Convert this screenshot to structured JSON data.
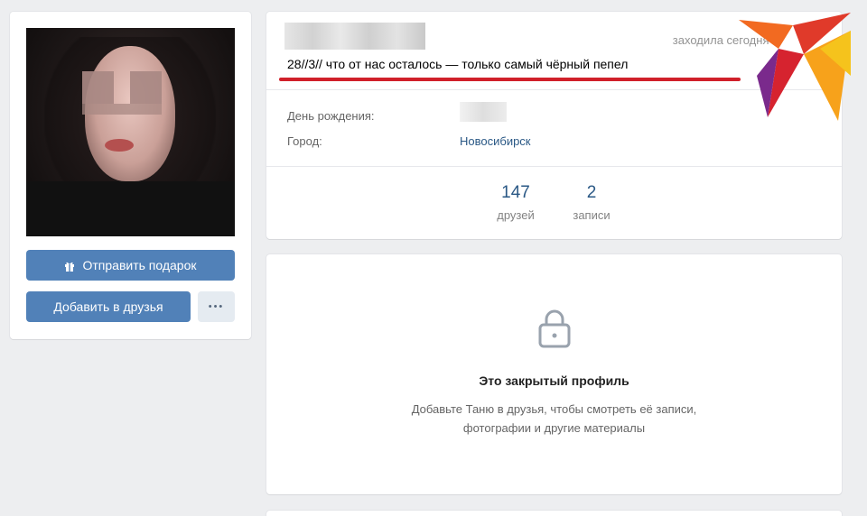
{
  "profile": {
    "status": "28//3// что от нас осталось — только самый чёрный пепел",
    "last_seen": "заходила сегодня в"
  },
  "info": {
    "birthday_label": "День рождения:",
    "city_label": "Город:",
    "city_value": "Новосибирск"
  },
  "counters": [
    {
      "num": "147",
      "label": "друзей"
    },
    {
      "num": "2",
      "label": "записи"
    }
  ],
  "actions": {
    "gift_label": "Отправить подарок",
    "add_friend_label": "Добавить в друзья",
    "more_label": "•••"
  },
  "closed_profile": {
    "title": "Это закрытый профиль",
    "description_line1": "Добавьте Таню в друзья, чтобы смотреть её записи,",
    "description_line2": "фотографии и другие материалы"
  },
  "colors": {
    "accent": "#5181b8",
    "highlight_underline": "#d0202a",
    "link": "#2a5885"
  },
  "icons": [
    "gift-icon",
    "lock-icon",
    "more-icon",
    "logo-bird"
  ]
}
